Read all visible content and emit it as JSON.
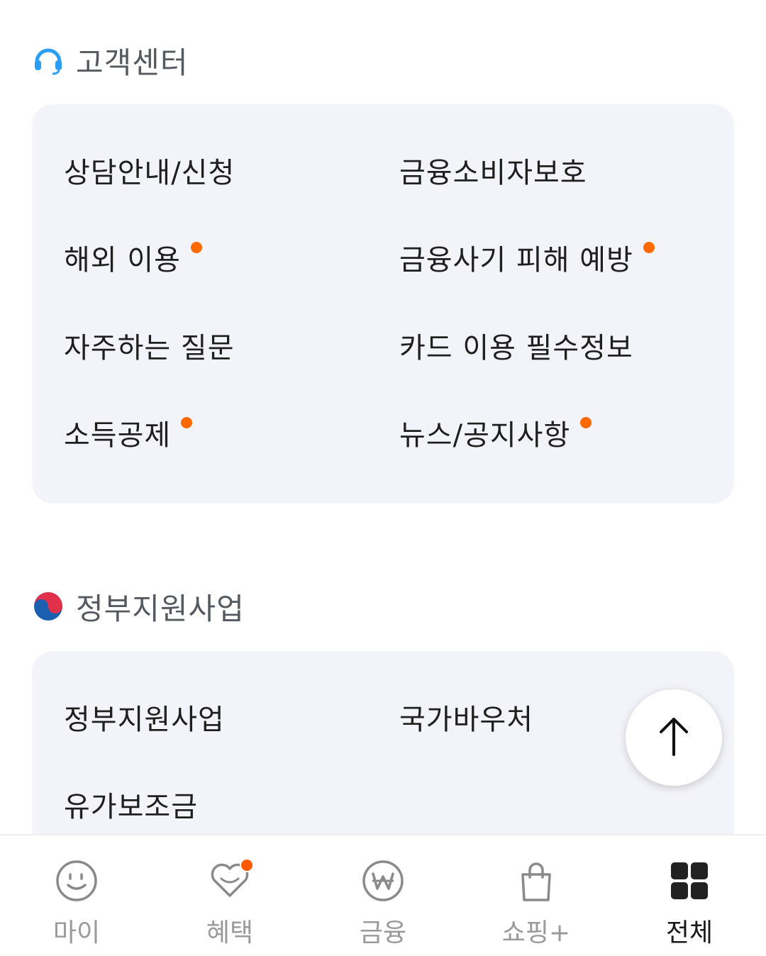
{
  "customer_center": {
    "title": "고객센터",
    "items": [
      {
        "label": "상담안내/신청",
        "dot": false
      },
      {
        "label": "금융소비자보호",
        "dot": false
      },
      {
        "label": "해외 이용",
        "dot": true
      },
      {
        "label": "금융사기 피해 예방",
        "dot": true
      },
      {
        "label": "자주하는 질문",
        "dot": false
      },
      {
        "label": "카드 이용 필수정보",
        "dot": false
      },
      {
        "label": "소득공제",
        "dot": true
      },
      {
        "label": "뉴스/공지사항",
        "dot": true
      }
    ]
  },
  "gov_support": {
    "title": "정부지원사업",
    "items": [
      {
        "label": "정부지원사업"
      },
      {
        "label": "국가바우처"
      },
      {
        "label": "유가보조금"
      }
    ]
  },
  "bottom_nav": {
    "items": [
      {
        "label": "마이",
        "icon": "smile-icon"
      },
      {
        "label": "혜택",
        "icon": "heart-icon"
      },
      {
        "label": "금융",
        "icon": "won-icon"
      },
      {
        "label": "쇼핑+",
        "icon": "shopping-bag-icon"
      },
      {
        "label": "전체",
        "icon": "grid-icon"
      }
    ],
    "active_index": 4
  },
  "colors": {
    "accent_dot": "#ff6a00",
    "headset_blue": "#2a9df4",
    "card_bg": "#f3f4f9"
  }
}
